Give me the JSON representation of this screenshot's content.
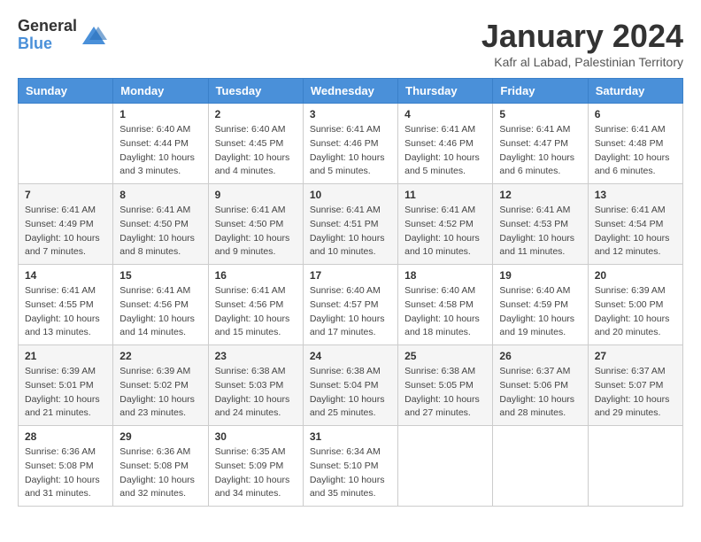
{
  "logo": {
    "general": "General",
    "blue": "Blue"
  },
  "title": "January 2024",
  "location": "Kafr al Labad, Palestinian Territory",
  "days_of_week": [
    "Sunday",
    "Monday",
    "Tuesday",
    "Wednesday",
    "Thursday",
    "Friday",
    "Saturday"
  ],
  "weeks": [
    [
      {
        "day": "",
        "info": ""
      },
      {
        "day": "1",
        "info": "Sunrise: 6:40 AM\nSunset: 4:44 PM\nDaylight: 10 hours\nand 3 minutes."
      },
      {
        "day": "2",
        "info": "Sunrise: 6:40 AM\nSunset: 4:45 PM\nDaylight: 10 hours\nand 4 minutes."
      },
      {
        "day": "3",
        "info": "Sunrise: 6:41 AM\nSunset: 4:46 PM\nDaylight: 10 hours\nand 5 minutes."
      },
      {
        "day": "4",
        "info": "Sunrise: 6:41 AM\nSunset: 4:46 PM\nDaylight: 10 hours\nand 5 minutes."
      },
      {
        "day": "5",
        "info": "Sunrise: 6:41 AM\nSunset: 4:47 PM\nDaylight: 10 hours\nand 6 minutes."
      },
      {
        "day": "6",
        "info": "Sunrise: 6:41 AM\nSunset: 4:48 PM\nDaylight: 10 hours\nand 6 minutes."
      }
    ],
    [
      {
        "day": "7",
        "info": "Sunrise: 6:41 AM\nSunset: 4:49 PM\nDaylight: 10 hours\nand 7 minutes."
      },
      {
        "day": "8",
        "info": "Sunrise: 6:41 AM\nSunset: 4:50 PM\nDaylight: 10 hours\nand 8 minutes."
      },
      {
        "day": "9",
        "info": "Sunrise: 6:41 AM\nSunset: 4:50 PM\nDaylight: 10 hours\nand 9 minutes."
      },
      {
        "day": "10",
        "info": "Sunrise: 6:41 AM\nSunset: 4:51 PM\nDaylight: 10 hours\nand 10 minutes."
      },
      {
        "day": "11",
        "info": "Sunrise: 6:41 AM\nSunset: 4:52 PM\nDaylight: 10 hours\nand 10 minutes."
      },
      {
        "day": "12",
        "info": "Sunrise: 6:41 AM\nSunset: 4:53 PM\nDaylight: 10 hours\nand 11 minutes."
      },
      {
        "day": "13",
        "info": "Sunrise: 6:41 AM\nSunset: 4:54 PM\nDaylight: 10 hours\nand 12 minutes."
      }
    ],
    [
      {
        "day": "14",
        "info": "Sunrise: 6:41 AM\nSunset: 4:55 PM\nDaylight: 10 hours\nand 13 minutes."
      },
      {
        "day": "15",
        "info": "Sunrise: 6:41 AM\nSunset: 4:56 PM\nDaylight: 10 hours\nand 14 minutes."
      },
      {
        "day": "16",
        "info": "Sunrise: 6:41 AM\nSunset: 4:56 PM\nDaylight: 10 hours\nand 15 minutes."
      },
      {
        "day": "17",
        "info": "Sunrise: 6:40 AM\nSunset: 4:57 PM\nDaylight: 10 hours\nand 17 minutes."
      },
      {
        "day": "18",
        "info": "Sunrise: 6:40 AM\nSunset: 4:58 PM\nDaylight: 10 hours\nand 18 minutes."
      },
      {
        "day": "19",
        "info": "Sunrise: 6:40 AM\nSunset: 4:59 PM\nDaylight: 10 hours\nand 19 minutes."
      },
      {
        "day": "20",
        "info": "Sunrise: 6:39 AM\nSunset: 5:00 PM\nDaylight: 10 hours\nand 20 minutes."
      }
    ],
    [
      {
        "day": "21",
        "info": "Sunrise: 6:39 AM\nSunset: 5:01 PM\nDaylight: 10 hours\nand 21 minutes."
      },
      {
        "day": "22",
        "info": "Sunrise: 6:39 AM\nSunset: 5:02 PM\nDaylight: 10 hours\nand 23 minutes."
      },
      {
        "day": "23",
        "info": "Sunrise: 6:38 AM\nSunset: 5:03 PM\nDaylight: 10 hours\nand 24 minutes."
      },
      {
        "day": "24",
        "info": "Sunrise: 6:38 AM\nSunset: 5:04 PM\nDaylight: 10 hours\nand 25 minutes."
      },
      {
        "day": "25",
        "info": "Sunrise: 6:38 AM\nSunset: 5:05 PM\nDaylight: 10 hours\nand 27 minutes."
      },
      {
        "day": "26",
        "info": "Sunrise: 6:37 AM\nSunset: 5:06 PM\nDaylight: 10 hours\nand 28 minutes."
      },
      {
        "day": "27",
        "info": "Sunrise: 6:37 AM\nSunset: 5:07 PM\nDaylight: 10 hours\nand 29 minutes."
      }
    ],
    [
      {
        "day": "28",
        "info": "Sunrise: 6:36 AM\nSunset: 5:08 PM\nDaylight: 10 hours\nand 31 minutes."
      },
      {
        "day": "29",
        "info": "Sunrise: 6:36 AM\nSunset: 5:08 PM\nDaylight: 10 hours\nand 32 minutes."
      },
      {
        "day": "30",
        "info": "Sunrise: 6:35 AM\nSunset: 5:09 PM\nDaylight: 10 hours\nand 34 minutes."
      },
      {
        "day": "31",
        "info": "Sunrise: 6:34 AM\nSunset: 5:10 PM\nDaylight: 10 hours\nand 35 minutes."
      },
      {
        "day": "",
        "info": ""
      },
      {
        "day": "",
        "info": ""
      },
      {
        "day": "",
        "info": ""
      }
    ]
  ]
}
